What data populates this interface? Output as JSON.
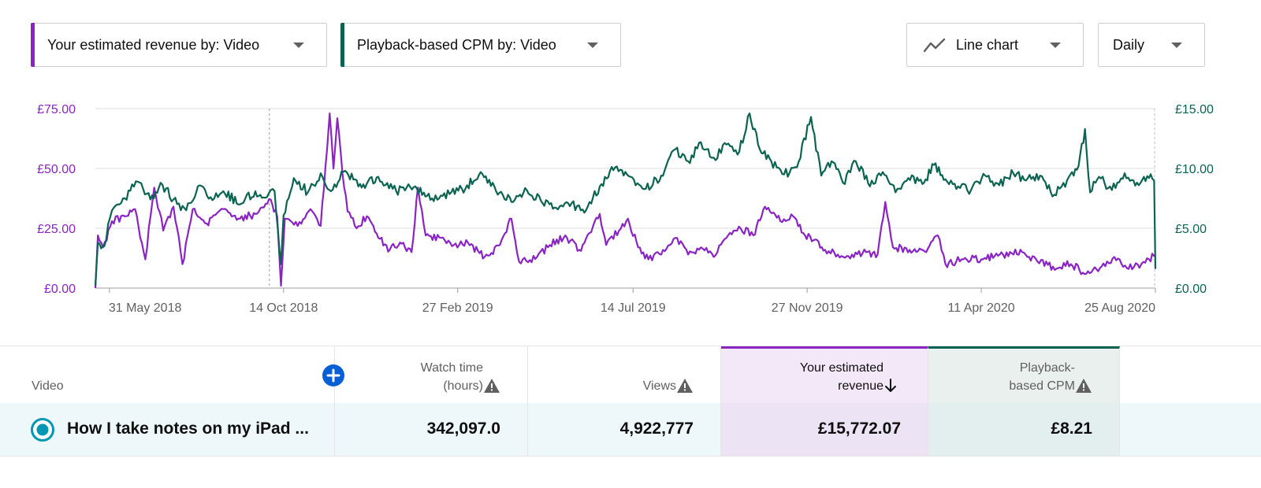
{
  "controls": {
    "metric1": {
      "label": "Your estimated revenue by: Video",
      "color": "#8a24c2"
    },
    "metric2": {
      "label": "Playback-based CPM by: Video",
      "color": "#0b6451"
    },
    "chart_type": {
      "label": "Line chart",
      "icon": "line-chart-icon"
    },
    "period": {
      "label": "Daily"
    }
  },
  "chart_data": {
    "type": "line",
    "x_start": "2018-05-20",
    "x_end": "2020-08-25",
    "xticks": [
      {
        "date": "2018-05-31",
        "label": "31 May 2018"
      },
      {
        "date": "2018-10-14",
        "label": "14 Oct 2018"
      },
      {
        "date": "2019-02-27",
        "label": "27 Feb 2019"
      },
      {
        "date": "2019-07-14",
        "label": "14 Jul 2019"
      },
      {
        "date": "2019-11-27",
        "label": "27 Nov 2019"
      },
      {
        "date": "2020-04-11",
        "label": "11 Apr 2020"
      },
      {
        "date": "2020-08-25",
        "label": "25 Aug 2020"
      }
    ],
    "y_left": {
      "ticks": [
        0,
        25,
        50,
        75
      ],
      "labels": [
        "£0.00",
        "£25.00",
        "£50.00",
        "£75.00"
      ],
      "range": [
        0,
        75
      ]
    },
    "y_right": {
      "ticks": [
        0,
        5,
        10,
        15
      ],
      "labels": [
        "£0.00",
        "£5.00",
        "£10.00",
        "£15.00"
      ],
      "range": [
        0,
        15
      ]
    },
    "grid": true,
    "series": [
      {
        "name": "Your estimated revenue",
        "axis": "left",
        "color": "#8a24c2",
        "points": [
          [
            "2018-05-20",
            0
          ],
          [
            "2018-05-22",
            22
          ],
          [
            "2018-05-26",
            17
          ],
          [
            "2018-06-02",
            28
          ],
          [
            "2018-06-12",
            30
          ],
          [
            "2018-06-20",
            33
          ],
          [
            "2018-06-28",
            12
          ],
          [
            "2018-07-05",
            42
          ],
          [
            "2018-07-12",
            24
          ],
          [
            "2018-07-20",
            34
          ],
          [
            "2018-07-27",
            10
          ],
          [
            "2018-08-04",
            33
          ],
          [
            "2018-08-15",
            27
          ],
          [
            "2018-08-28",
            33
          ],
          [
            "2018-09-10",
            29
          ],
          [
            "2018-09-22",
            31
          ],
          [
            "2018-10-04",
            37
          ],
          [
            "2018-10-09",
            30
          ],
          [
            "2018-10-12",
            1
          ],
          [
            "2018-10-15",
            29
          ],
          [
            "2018-10-25",
            26
          ],
          [
            "2018-11-04",
            33
          ],
          [
            "2018-11-12",
            26
          ],
          [
            "2018-11-17",
            58
          ],
          [
            "2018-11-19",
            73
          ],
          [
            "2018-11-22",
            50
          ],
          [
            "2018-11-25",
            71
          ],
          [
            "2018-11-29",
            48
          ],
          [
            "2018-12-03",
            32
          ],
          [
            "2018-12-10",
            25
          ],
          [
            "2018-12-18",
            30
          ],
          [
            "2018-12-27",
            21
          ],
          [
            "2019-01-05",
            16
          ],
          [
            "2019-01-13",
            19
          ],
          [
            "2019-01-22",
            15
          ],
          [
            "2019-01-27",
            42
          ],
          [
            "2019-02-02",
            22
          ],
          [
            "2019-02-14",
            21
          ],
          [
            "2019-02-24",
            18
          ],
          [
            "2019-03-07",
            19
          ],
          [
            "2019-03-20",
            13
          ],
          [
            "2019-04-01",
            18
          ],
          [
            "2019-04-10",
            29
          ],
          [
            "2019-04-16",
            11
          ],
          [
            "2019-04-30",
            13
          ],
          [
            "2019-05-10",
            18
          ],
          [
            "2019-05-22",
            22
          ],
          [
            "2019-06-02",
            16
          ],
          [
            "2019-06-10",
            23
          ],
          [
            "2019-06-18",
            31
          ],
          [
            "2019-06-23",
            18
          ],
          [
            "2019-07-03",
            24
          ],
          [
            "2019-07-10",
            29
          ],
          [
            "2019-07-18",
            17
          ],
          [
            "2019-07-26",
            12
          ],
          [
            "2019-08-05",
            14
          ],
          [
            "2019-08-16",
            21
          ],
          [
            "2019-08-26",
            14
          ],
          [
            "2019-09-05",
            17
          ],
          [
            "2019-09-15",
            13
          ],
          [
            "2019-09-25",
            21
          ],
          [
            "2019-10-06",
            25
          ],
          [
            "2019-10-16",
            22
          ],
          [
            "2019-10-25",
            34
          ],
          [
            "2019-11-06",
            28
          ],
          [
            "2019-11-16",
            30
          ],
          [
            "2019-11-24",
            23
          ],
          [
            "2019-12-02",
            20
          ],
          [
            "2019-12-11",
            16
          ],
          [
            "2019-12-21",
            14
          ],
          [
            "2020-01-01",
            14
          ],
          [
            "2020-01-12",
            15
          ],
          [
            "2020-01-21",
            14
          ],
          [
            "2020-01-27",
            36
          ],
          [
            "2020-02-02",
            17
          ],
          [
            "2020-02-15",
            16
          ],
          [
            "2020-02-28",
            15
          ],
          [
            "2020-03-08",
            22
          ],
          [
            "2020-03-14",
            10
          ],
          [
            "2020-03-28",
            12
          ],
          [
            "2020-04-11",
            12
          ],
          [
            "2020-04-28",
            14
          ],
          [
            "2020-05-13",
            15
          ],
          [
            "2020-05-25",
            11
          ],
          [
            "2020-06-06",
            9
          ],
          [
            "2020-06-20",
            10
          ],
          [
            "2020-07-02",
            6
          ],
          [
            "2020-07-14",
            9
          ],
          [
            "2020-07-24",
            13
          ],
          [
            "2020-08-04",
            8
          ],
          [
            "2020-08-14",
            10
          ],
          [
            "2020-08-20",
            12
          ],
          [
            "2020-08-25",
            14
          ]
        ]
      },
      {
        "name": "Playback-based CPM",
        "axis": "right",
        "color": "#0b6451",
        "points": [
          [
            "2018-05-20",
            0.2
          ],
          [
            "2018-05-22",
            3.8
          ],
          [
            "2018-05-27",
            3.5
          ],
          [
            "2018-06-02",
            6.5
          ],
          [
            "2018-06-12",
            7.5
          ],
          [
            "2018-06-22",
            8.9
          ],
          [
            "2018-07-02",
            7.4
          ],
          [
            "2018-07-10",
            8.8
          ],
          [
            "2018-07-20",
            7.4
          ],
          [
            "2018-07-30",
            6.5
          ],
          [
            "2018-08-08",
            8.5
          ],
          [
            "2018-08-18",
            7.6
          ],
          [
            "2018-08-28",
            8.1
          ],
          [
            "2018-09-10",
            7.0
          ],
          [
            "2018-09-22",
            8.1
          ],
          [
            "2018-10-01",
            7.6
          ],
          [
            "2018-10-07",
            8.1
          ],
          [
            "2018-10-12",
            2.0
          ],
          [
            "2018-10-14",
            6.1
          ],
          [
            "2018-10-22",
            9.2
          ],
          [
            "2018-11-02",
            8.0
          ],
          [
            "2018-11-12",
            9.6
          ],
          [
            "2018-11-20",
            8.1
          ],
          [
            "2018-12-01",
            9.8
          ],
          [
            "2018-12-14",
            8.4
          ],
          [
            "2018-12-27",
            9.3
          ],
          [
            "2019-01-10",
            8.1
          ],
          [
            "2019-01-25",
            8.5
          ],
          [
            "2019-02-07",
            7.5
          ],
          [
            "2019-02-22",
            8.0
          ],
          [
            "2019-03-05",
            8.3
          ],
          [
            "2019-03-17",
            9.7
          ],
          [
            "2019-03-29",
            8.1
          ],
          [
            "2019-04-10",
            7.2
          ],
          [
            "2019-04-22",
            8.2
          ],
          [
            "2019-05-03",
            7.3
          ],
          [
            "2019-05-15",
            6.7
          ],
          [
            "2019-05-27",
            7.1
          ],
          [
            "2019-06-06",
            6.3
          ],
          [
            "2019-06-18",
            8.5
          ],
          [
            "2019-06-30",
            10.1
          ],
          [
            "2019-07-12",
            9.3
          ],
          [
            "2019-07-24",
            8.3
          ],
          [
            "2019-08-05",
            9.4
          ],
          [
            "2019-08-16",
            11.6
          ],
          [
            "2019-08-26",
            10.6
          ],
          [
            "2019-09-05",
            12.2
          ],
          [
            "2019-09-15",
            10.9
          ],
          [
            "2019-09-25",
            12.0
          ],
          [
            "2019-10-05",
            11.4
          ],
          [
            "2019-10-13",
            14.6
          ],
          [
            "2019-10-21",
            11.6
          ],
          [
            "2019-10-30",
            10.6
          ],
          [
            "2019-11-09",
            9.5
          ],
          [
            "2019-11-19",
            10.1
          ],
          [
            "2019-11-30",
            14.3
          ],
          [
            "2019-12-08",
            9.4
          ],
          [
            "2019-12-16",
            10.6
          ],
          [
            "2019-12-25",
            8.8
          ],
          [
            "2020-01-04",
            10.6
          ],
          [
            "2020-01-15",
            8.5
          ],
          [
            "2020-01-25",
            9.7
          ],
          [
            "2020-02-04",
            8.0
          ],
          [
            "2020-02-14",
            9.2
          ],
          [
            "2020-02-25",
            8.7
          ],
          [
            "2020-03-05",
            10.3
          ],
          [
            "2020-03-14",
            9.1
          ],
          [
            "2020-03-24",
            8.5
          ],
          [
            "2020-04-03",
            8.2
          ],
          [
            "2020-04-14",
            9.4
          ],
          [
            "2020-04-25",
            8.6
          ],
          [
            "2020-05-06",
            9.6
          ],
          [
            "2020-05-16",
            9.0
          ],
          [
            "2020-05-27",
            9.4
          ],
          [
            "2020-06-07",
            7.8
          ],
          [
            "2020-06-17",
            9.0
          ],
          [
            "2020-06-26",
            10.2
          ],
          [
            "2020-07-01",
            13.3
          ],
          [
            "2020-07-05",
            8.0
          ],
          [
            "2020-07-12",
            9.3
          ],
          [
            "2020-07-22",
            8.2
          ],
          [
            "2020-08-01",
            9.6
          ],
          [
            "2020-08-12",
            8.6
          ],
          [
            "2020-08-20",
            9.2
          ],
          [
            "2020-08-24",
            9.0
          ],
          [
            "2020-08-25",
            1.6
          ]
        ]
      }
    ]
  },
  "table": {
    "columns": {
      "video": {
        "label": "Video"
      },
      "watch_time": {
        "line1": "Watch time",
        "line2": "(hours)"
      },
      "views": {
        "line1": "Views"
      },
      "revenue": {
        "line1": "Your estimated",
        "line2": "revenue",
        "color": "#8a24c2"
      },
      "cpm": {
        "line1": "Playback-",
        "line2": "based CPM",
        "color": "#0b6451"
      }
    },
    "rows": [
      {
        "title": "How I take notes on my iPad ...",
        "watch_time": "342,097.0",
        "views": "4,922,777",
        "revenue": "£15,772.07",
        "cpm": "£8.21"
      }
    ]
  }
}
